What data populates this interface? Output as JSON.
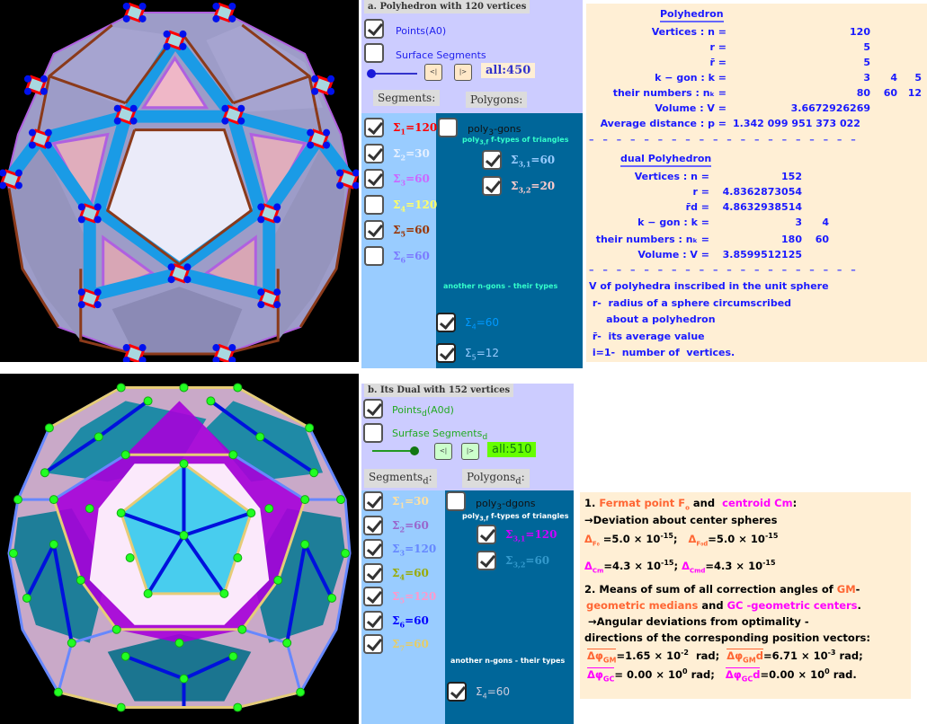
{
  "panel_a": {
    "title": "a. Polyhedron with 120 vertices",
    "points_label": "Points(A0)",
    "points_checked": true,
    "surface_label": "Surface Segments",
    "surface_checked": false,
    "slider_value": 0,
    "prev_label": "<|",
    "next_label": "|>",
    "all_label": "all:450",
    "segments_header": "Segments:",
    "polygons_header": "Polygons:",
    "segments": [
      {
        "sym": "Σ",
        "sub": "1",
        "text": "=120",
        "checked": true,
        "color": "#ff0000"
      },
      {
        "sym": "Σ",
        "sub": "2",
        "text": "=30",
        "checked": true,
        "color": "#e6f0ff"
      },
      {
        "sym": "Σ",
        "sub": "3",
        "text": "=60",
        "checked": true,
        "color": "#cc66ff"
      },
      {
        "sym": "Σ",
        "sub": "4",
        "text": "=120",
        "checked": false,
        "color": "#ffff66"
      },
      {
        "sym": "Σ",
        "sub": "5",
        "text": "=60",
        "checked": true,
        "color": "#993300"
      },
      {
        "sym": "Σ",
        "sub": "6",
        "text": "=60",
        "checked": false,
        "color": "#7b7bff"
      }
    ],
    "polygon_main": {
      "label": "poly",
      "sub": "3",
      "suffix": "-gons",
      "checked": false
    },
    "ftypes_label": {
      "prefix": "poly",
      "sub": "3,f",
      "suffix": "  f-types of triangles"
    },
    "triangle_types": [
      {
        "sym": "Σ",
        "sub": "3,1",
        "text": "=60",
        "checked": true,
        "color": "#99ccff"
      },
      {
        "sym": "Σ",
        "sub": "3,2",
        "text": "=20",
        "checked": true,
        "color": "#ffcccc"
      }
    ],
    "other_label": "another n-gons -  their types",
    "other_types": [
      {
        "sym": "Σ",
        "sub": "4",
        "text": "=60",
        "checked": true,
        "color": "#0099ff"
      },
      {
        "sym": "Σ",
        "sub": "5",
        "text": "=12",
        "checked": true,
        "color": "#99ccff"
      }
    ]
  },
  "panel_b": {
    "title": "b. Its Dual with 152  vertices",
    "points_label": "Points",
    "points_sub": "d",
    "points_suffix": "(A0d)",
    "points_checked": true,
    "surface_label": "Surfase Segments",
    "surface_sub": "d",
    "surface_checked": false,
    "slider_value": 1,
    "prev_label": "<|",
    "next_label": "|>",
    "all_label": "all:510",
    "segments_header": "Segments",
    "segments_header_sub": "d",
    "segments_header_suffix": ":",
    "polygons_header": "Polygons",
    "polygons_header_sub": "d",
    "polygons_header_suffix": ":",
    "segments": [
      {
        "sym": "Σ",
        "sub": "1",
        "text": "=30",
        "checked": true,
        "color": "#ffe0a0"
      },
      {
        "sym": "Σ",
        "sub": "2",
        "text": "=60",
        "checked": true,
        "color": "#9966cc"
      },
      {
        "sym": "Σ",
        "sub": "3",
        "text": "=120",
        "checked": true,
        "color": "#6688ff"
      },
      {
        "sym": "Σ",
        "sub": "4",
        "text": "=60",
        "checked": true,
        "color": "#99aa00"
      },
      {
        "sym": "Σ",
        "sub": "5",
        "text": "=120",
        "checked": true,
        "color": "#ff99cc"
      },
      {
        "sym": "Σ",
        "sub": "6",
        "text": "=60",
        "checked": true,
        "color": "#0000ff"
      },
      {
        "sym": "Σ",
        "sub": "7",
        "text": "=60",
        "checked": true,
        "color": "#e6cc66"
      }
    ],
    "polygon_main": {
      "label": "poly",
      "sub": "3",
      "suffix": "-dgons",
      "checked": false
    },
    "ftypes_label": {
      "prefix": "poly",
      "sub": "3,f",
      "suffix": "  f-types of triangles"
    },
    "triangle_types": [
      {
        "sym": "Σ",
        "sub": "3,1",
        "text": "=120",
        "checked": true,
        "color": "#cc00ff"
      },
      {
        "sym": "Σ",
        "sub": "3,2",
        "text": "=60",
        "checked": true,
        "color": "#3399cc"
      }
    ],
    "other_label": "another n-gons -  their types",
    "other_types": [
      {
        "sym": "Σ",
        "sub": "4",
        "text": "=60",
        "checked": true,
        "color": "#ccccdd"
      }
    ]
  },
  "info_poly": {
    "title": "Polyhedron",
    "vertices_label": "Vertices : n =",
    "vertices": "120",
    "r_label": "r =",
    "r": "5",
    "rbar_label": "r̄ =",
    "rbar": "5",
    "kgon_label": "k − gon : k =",
    "kgon": [
      "3",
      "4",
      "5"
    ],
    "nk_label": "their numbers : nₖ =",
    "nk": [
      "80",
      "60",
      "12"
    ],
    "volume_label": "Volume : V =",
    "volume": "3.6672926269",
    "avg_label": "Average distance : p =",
    "avg": "1.342 099 951 373 022",
    "dashes": "– – – – – – – – – – – – – – – – – – – –",
    "dual_title": "dual Polyhedron",
    "dual_vertices_label": "Vertices : n =",
    "dual_vertices": "152",
    "dual_r_label": "r =",
    "dual_r": "4.8362873054",
    "dual_rd_label": "r̄d =",
    "dual_rd": "4.8632938514",
    "dual_kgon_label": "k − gon : k =",
    "dual_kgon": [
      "3",
      "4"
    ],
    "dual_nk_label": "their numbers : nₖ =",
    "dual_nk": [
      "180",
      "60"
    ],
    "dual_volume_label": "Volume : V =",
    "dual_volume": "3.8599512125",
    "notes": [
      "V of polyhedra inscribed in the unit sphere",
      " r-  radius of a sphere circumscribed",
      "     about a polyhedron",
      " r̄-  its average value",
      " i=1-  number of  vertices."
    ]
  },
  "info_dev": {
    "l1_num": "1. ",
    "l1_fermat": "Fermat point  F",
    "l1_fermat_sub": "o",
    "l1_and": " and  ",
    "l1_centroid": "centroid Cm",
    "l1_colon": ":",
    "l2": "→Deviation about center spheres",
    "dF_lbl": "Δ",
    "dF_sub": "F₀",
    "dF_val": " =5.0 × 10",
    "dF_exp": "-15",
    "dFd_sub": "F₀d",
    "dFd_val": "=5.0 × 10",
    "dFd_exp": "-15",
    "dC_sub": "Cm",
    "dC_val": "=4.3 × 10",
    "dC_exp": "-15",
    "dCd_sub": "Cmd",
    "dCd_val": "=4.3 × 10",
    "dCd_exp": "-15",
    "l5a": "2. Means of sum of all correction angles of ",
    "l5_gm": "GM",
    "l5b": "-",
    "l6_gm": "geometric medians",
    "l6_and": " and ",
    "l6_gc": "GC",
    "l6_gc2": " -geometric centers",
    "l6_dot": ".",
    "l7": " →Angular deviations from optimality -",
    "l8": "directions of the corresponding position vectors:",
    "gm_sub": "GM",
    "gm_val": "=1.65 × 10",
    "gm_exp": "-2",
    "gm_unit": "  rad;  ",
    "gmd_sub": "GM",
    "gmd_val": "=6.71 × 10",
    "gmd_exp": "-3",
    "gmd_unit": " rad;",
    "gc_sub": "GC",
    "gc_val": "= 0.00 × 10",
    "gc_exp": "0",
    "gc_unit": " rad;   ",
    "gcd_sub": "GC",
    "gcd_val": "=0.00 × 10",
    "gcd_exp": "0",
    "gcd_unit": " rad."
  },
  "colors": {
    "panel_bg": "#ccccff",
    "left_col": "#99ccff",
    "right_col": "#006699",
    "info_bg": "#ffefd5",
    "info_text": "#1a1aff"
  }
}
